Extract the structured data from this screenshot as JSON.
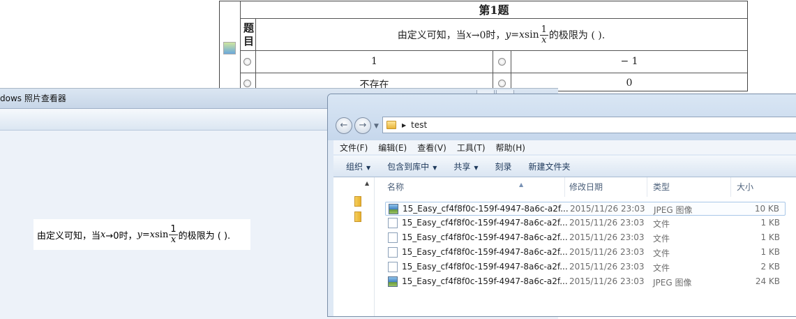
{
  "quiz": {
    "title": "第1题",
    "stem_label": "题目",
    "stem": {
      "prefix": "由定义可知，当",
      "var_x": "x",
      "arrow": "→0时，",
      "lhs": "y",
      "eq": " = ",
      "expr_x": "x",
      "fn": "sin",
      "frac_num": "1",
      "frac_den": "x",
      "suffix": "的极限为 (  )."
    },
    "options": [
      "1",
      "− 1",
      "不存在",
      "0"
    ]
  },
  "viewer": {
    "title": "dows 照片查看器",
    "photo": {
      "prefix": "由定义可知，当",
      "var_x": "x",
      "arrow": "→0时，",
      "lhs": "y",
      "eq": " = ",
      "expr_x": "x",
      "fn": "sin",
      "frac_num": "1",
      "frac_den": "x",
      "suffix": "的极限为 (  )."
    }
  },
  "explorer": {
    "path": "test",
    "menu": [
      "文件(F)",
      "编辑(E)",
      "查看(V)",
      "工具(T)",
      "帮助(H)"
    ],
    "toolbar": {
      "organize": "组织",
      "include": "包含到库中",
      "share": "共享",
      "burn": "刻录",
      "new_folder": "新建文件夹"
    },
    "columns": {
      "name": "名称",
      "date": "修改日期",
      "type": "类型",
      "size": "大小"
    },
    "files": [
      {
        "name": "15_Easy_cf4f8f0c-159f-4947-8a6c-a2f...",
        "date": "2015/11/26 23:03",
        "type": "JPEG 图像",
        "size": "10 KB",
        "icon": "jpeg-icon"
      },
      {
        "name": "15_Easy_cf4f8f0c-159f-4947-8a6c-a2f...",
        "date": "2015/11/26 23:03",
        "type": "文件",
        "size": "1 KB",
        "icon": "file-icon"
      },
      {
        "name": "15_Easy_cf4f8f0c-159f-4947-8a6c-a2f...",
        "date": "2015/11/26 23:03",
        "type": "文件",
        "size": "1 KB",
        "icon": "file-icon"
      },
      {
        "name": "15_Easy_cf4f8f0c-159f-4947-8a6c-a2f...",
        "date": "2015/11/26 23:03",
        "type": "文件",
        "size": "1 KB",
        "icon": "file-icon"
      },
      {
        "name": "15_Easy_cf4f8f0c-159f-4947-8a6c-a2f...",
        "date": "2015/11/26 23:03",
        "type": "文件",
        "size": "2 KB",
        "icon": "file-icon"
      },
      {
        "name": "15_Easy_cf4f8f0c-159f-4947-8a6c-a2f...",
        "date": "2015/11/26 23:03",
        "type": "JPEG 图像",
        "size": "24 KB",
        "icon": "jpeg-icon"
      }
    ]
  }
}
